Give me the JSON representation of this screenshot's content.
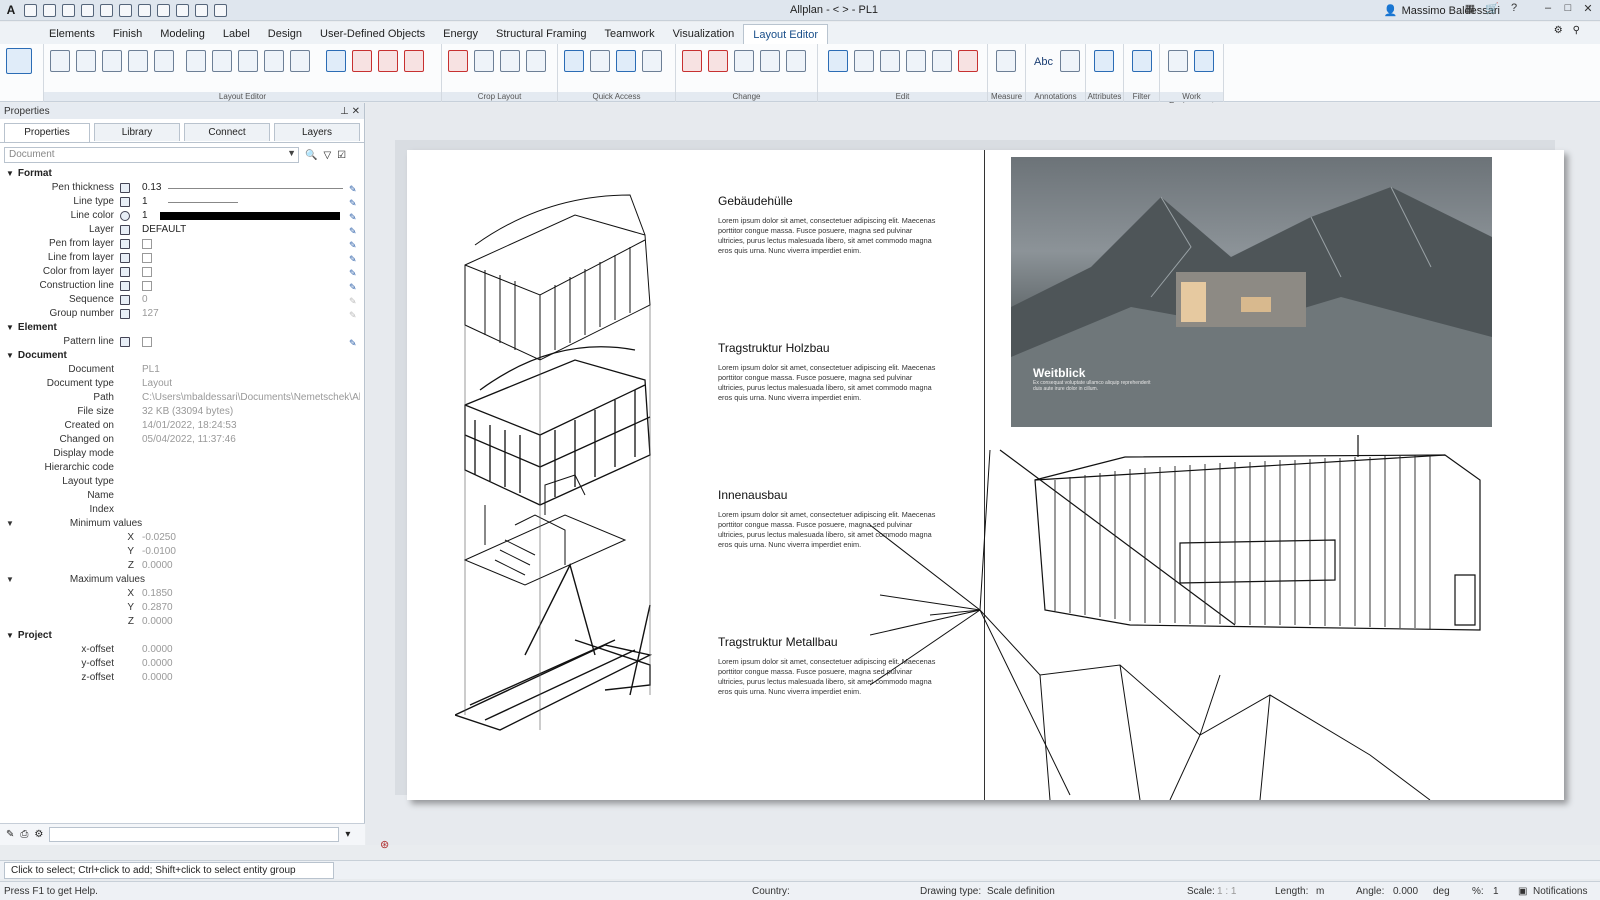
{
  "window": {
    "title": "Allplan - <          > - PL1",
    "user": "Massimo Baldessari"
  },
  "menu": [
    "Elements",
    "Finish",
    "Modeling",
    "Label",
    "Design",
    "User-Defined Objects",
    "Energy",
    "Structural Framing",
    "Teamwork",
    "Visualization",
    "Layout Editor"
  ],
  "ribbon": {
    "groups": [
      "Layout Editor",
      "Crop Layout",
      "Quick Access",
      "Change",
      "Edit",
      "Measure",
      "Annotations",
      "Attributes",
      "Filter",
      "Work Environment"
    ],
    "abc_label": "Abc"
  },
  "panel": {
    "title": "Properties",
    "tabs": [
      "Properties",
      "Library",
      "Connect",
      "Layers"
    ],
    "selector_placeholder": "Document",
    "sections": {
      "format": "Format",
      "element": "Element",
      "document": "Document",
      "project": "Project",
      "min": "Minimum values",
      "max": "Maximum values"
    },
    "format": {
      "pen_thickness_label": "Pen thickness",
      "pen_thickness": "0.13",
      "line_type_label": "Line type",
      "line_type": "1",
      "line_color_label": "Line color",
      "line_color": "1",
      "layer_label": "Layer",
      "layer": "DEFAULT",
      "pen_from_layer_label": "Pen from layer",
      "line_from_layer_label": "Line from layer",
      "color_from_layer_label": "Color from layer",
      "construction_line_label": "Construction line",
      "sequence_label": "Sequence",
      "sequence": "0",
      "group_number_label": "Group number",
      "group_number": "127"
    },
    "element": {
      "pattern_line_label": "Pattern line"
    },
    "document": {
      "document_label": "Document",
      "document": "PL1",
      "type_label": "Document type",
      "type": "Layout",
      "path_label": "Path",
      "path": "C:\\Users\\mbaldessari\\Documents\\Nemetschek\\Allpl",
      "size_label": "File size",
      "size": "32 KB (33094 bytes)",
      "created_label": "Created on",
      "created": "14/01/2022, 18:24:53",
      "changed_label": "Changed on",
      "changed": "05/04/2022, 11:37:46",
      "display_mode_label": "Display mode",
      "hierarchic_label": "Hierarchic code",
      "layout_type_label": "Layout type",
      "name_label": "Name",
      "index_label": "Index"
    },
    "min": {
      "x": "-0.0250",
      "y": "-0.0100",
      "z": "0.0000"
    },
    "max": {
      "x": "0.1850",
      "y": "0.2870",
      "z": "0.0000"
    },
    "project": {
      "x_label": "x-offset",
      "x": "0.0000",
      "y_label": "y-offset",
      "y": "0.0000",
      "z_label": "z-offset",
      "z": "0.0000"
    }
  },
  "layout": {
    "blocks": [
      {
        "title": "Gebäudehülle",
        "text": "Lorem ipsum dolor sit amet, consectetuer adipiscing elit. Maecenas porttitor congue massa. Fusce posuere, magna sed pulvinar ultricies, purus lectus malesuada libero, sit amet commodo magna eros quis urna. Nunc viverra imperdiet enim."
      },
      {
        "title": "Tragstruktur Holzbau",
        "text": "Lorem ipsum dolor sit amet, consectetuer adipiscing elit. Maecenas porttitor congue massa. Fusce posuere, magna sed pulvinar ultricies, purus lectus malesuada libero, sit amet commodo magna eros quis urna. Nunc viverra imperdiet enim."
      },
      {
        "title": "Innenausbau",
        "text": "Lorem ipsum dolor sit amet, consectetuer adipiscing elit. Maecenas porttitor congue massa. Fusce posuere, magna sed pulvinar ultricies, purus lectus malesuada libero, sit amet commodo magna eros quis urna. Nunc viverra imperdiet enim."
      },
      {
        "title": "Tragstruktur Metallbau",
        "text": "Lorem ipsum dolor sit amet, consectetuer adipiscing elit. Maecenas porttitor congue massa. Fusce posuere, magna sed pulvinar ultricies, purus lectus malesuada libero, sit amet commodo magna eros quis urna. Nunc viverra imperdiet enim."
      }
    ],
    "photo_title": "Weitblick",
    "photo_caption": "Ex consequat voluptate ullamco aliquip reprehenderit duis aute irure dolor in cillum."
  },
  "hint": "Click to select; Ctrl+click to add; Shift+click to select entity group",
  "status": {
    "help": "Press F1 to get Help.",
    "country_label": "Country:",
    "drawing_type_label": "Drawing type:",
    "drawing_type": "Scale definition",
    "scale_label": "Scale:",
    "scale": "1 : 1",
    "length_label": "Length:",
    "length": "m",
    "angle_label": "Angle:",
    "angle": "0.000",
    "angle_unit": "deg",
    "percent_label": "%:",
    "percent": "1",
    "notifications": "Notifications"
  }
}
